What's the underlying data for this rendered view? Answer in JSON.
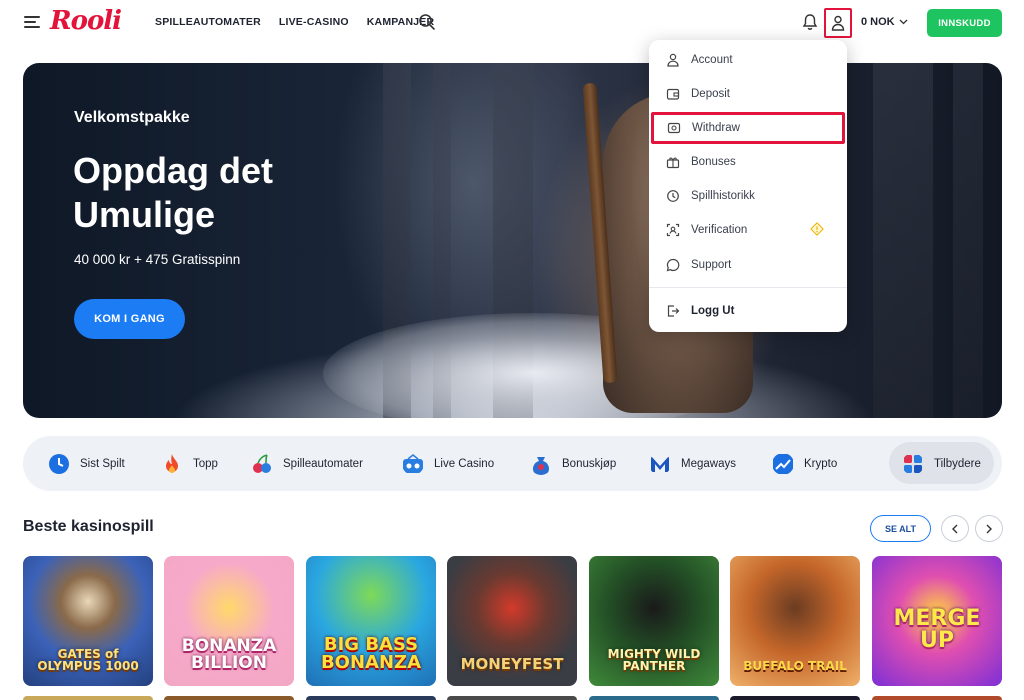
{
  "header": {
    "logo": "Rooli",
    "nav": [
      "SPILLEAUTOMATER",
      "LIVE-CASINO",
      "KAMPANJER"
    ],
    "balance": "0 NOK",
    "deposit_label": "INNSKUDD"
  },
  "hero": {
    "subtitle": "Velkomstpakke",
    "title": "Oppdag det Umulige",
    "offer": "40 000 kr + 475 Gratisspinn",
    "cta": "KOM I GANG"
  },
  "account_menu": {
    "items": [
      {
        "label": "Account",
        "icon": "user-icon"
      },
      {
        "label": "Deposit",
        "icon": "wallet-icon"
      },
      {
        "label": "Withdraw",
        "icon": "cash-out-icon",
        "highlighted": true
      },
      {
        "label": "Bonuses",
        "icon": "gift-icon"
      },
      {
        "label": "Spillhistorikk",
        "icon": "history-icon"
      },
      {
        "label": "Verification",
        "icon": "id-verify-icon",
        "badge": "warning-icon"
      },
      {
        "label": "Support",
        "icon": "chat-icon"
      }
    ],
    "logout": "Logg Ut"
  },
  "categories": [
    {
      "label": "Sist Spilt",
      "icon": "clock-icon",
      "color": "#1b6fe0"
    },
    {
      "label": "Topp",
      "icon": "flame-icon",
      "color": "#f04a2a"
    },
    {
      "label": "Spilleautomater",
      "icon": "slot-cherry-icon",
      "color": "#e03050"
    },
    {
      "label": "Live Casino",
      "icon": "live-casino-icon",
      "color": "#2a7de0"
    },
    {
      "label": "Bonuskjøp",
      "icon": "bonus-bag-icon",
      "color": "#2a6fd0"
    },
    {
      "label": "Megaways",
      "icon": "megaways-icon",
      "color": "#1b55c0"
    },
    {
      "label": "Krypto",
      "icon": "crypto-chart-icon",
      "color": "#1b6fe0"
    },
    {
      "label": "Tilbydere",
      "icon": "providers-icon",
      "color": "#e03050",
      "active": true
    }
  ],
  "section": {
    "title": "Beste kasinospill",
    "see_all": "SE ALT"
  },
  "games": [
    {
      "title": "GATES of OLYMPUS 1000",
      "bg": "#3b62b8"
    },
    {
      "title": "BONANZA BILLION",
      "bg": "#f2a7c4"
    },
    {
      "title": "BIG BASS BONANZA",
      "bg": "#1f8fd6"
    },
    {
      "title": "MONEYFEST",
      "bg": "#3a3d44"
    },
    {
      "title": "MIGHTY WILD PANTHER",
      "bg": "#1d4a22"
    },
    {
      "title": "BUFFALO TRAIL",
      "bg": "#c4662a"
    },
    {
      "title": "MERGE UP",
      "bg": "#7c2fd6"
    }
  ],
  "colors": {
    "brand_red": "#e3143c",
    "primary_blue": "#1b7cf4",
    "deposit_green": "#1ec45f"
  }
}
